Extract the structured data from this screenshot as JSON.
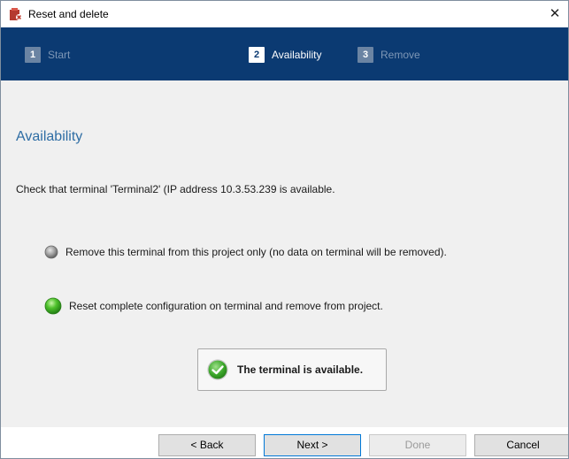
{
  "window": {
    "title": "Reset and delete",
    "close_glyph": "✕",
    "icon": "app-icon-red"
  },
  "steps": [
    {
      "number": "1",
      "label": "Start",
      "state": "inactive"
    },
    {
      "number": "2",
      "label": "Availability",
      "state": "active"
    },
    {
      "number": "3",
      "label": "Remove",
      "state": "inactive"
    }
  ],
  "content": {
    "heading": "Availability",
    "check_text": "Check that terminal 'Terminal2' (IP address 10.3.53.239 is available.",
    "options": [
      {
        "label": "Remove this terminal from this project only (no data on terminal will be removed).",
        "selected": false
      },
      {
        "label": "Reset complete configuration on terminal and remove from project.",
        "selected": true
      }
    ],
    "status": {
      "text": "The terminal is available.",
      "icon": "check-circle-icon"
    }
  },
  "buttons": {
    "back": "< Back",
    "next": "Next >",
    "done": "Done",
    "cancel": "Cancel"
  },
  "colors": {
    "header_bg": "#0b3a72",
    "heading": "#2e6da4",
    "accent_green": "#3aa529"
  }
}
